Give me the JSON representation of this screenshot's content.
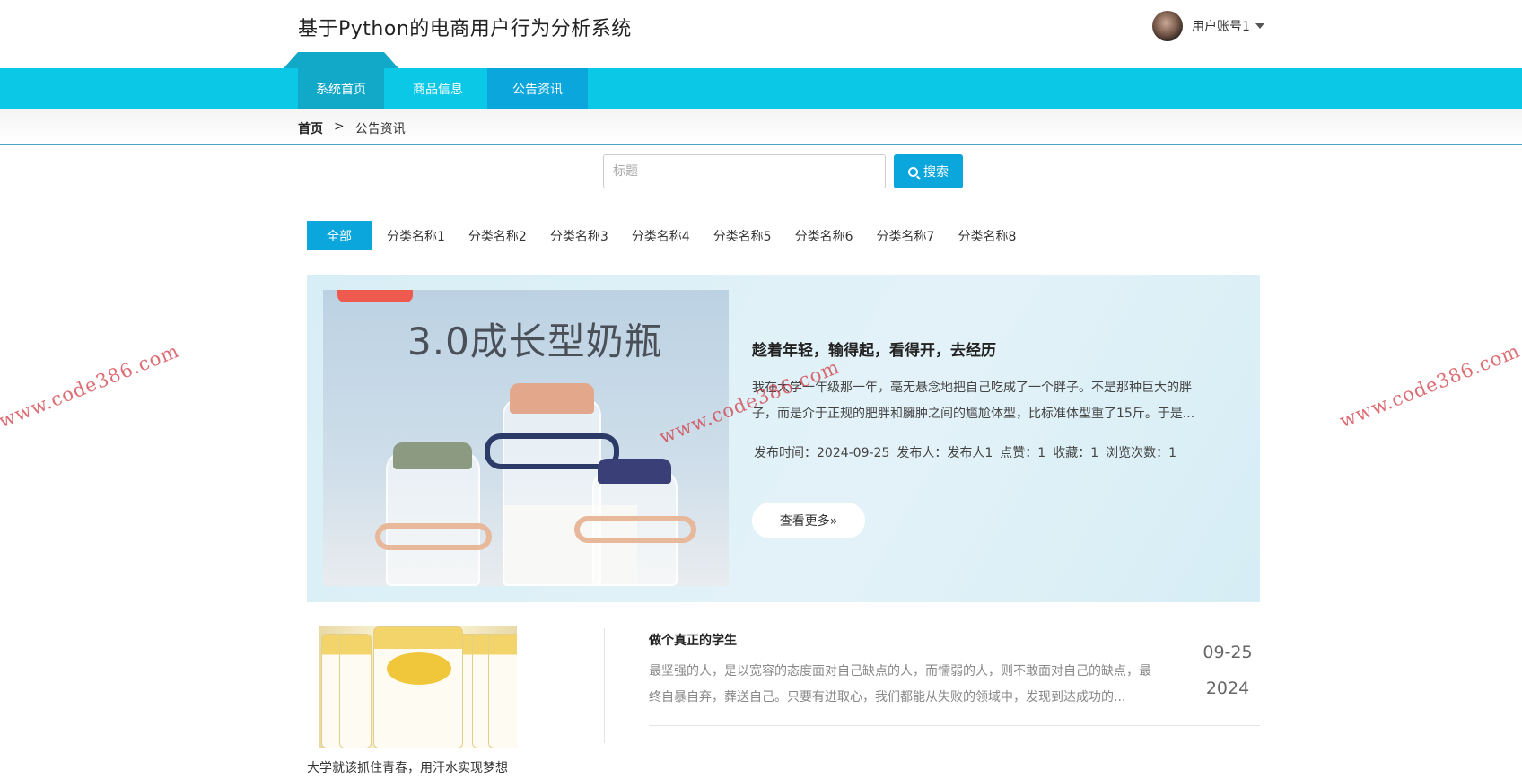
{
  "header": {
    "site_title": "基于Python的电商用户行为分析系统",
    "user_name": "用户账号1"
  },
  "nav": {
    "tabs": [
      {
        "label": "系统首页",
        "active": true
      },
      {
        "label": "商品信息",
        "active": false
      },
      {
        "label": "公告资讯",
        "active": false
      }
    ]
  },
  "breadcrumb": {
    "home": "首页",
    "separator": ">",
    "current": "公告资讯"
  },
  "search": {
    "placeholder": "标题",
    "value": "",
    "button_label": "搜索"
  },
  "categories": [
    "全部",
    "分类名称1",
    "分类名称2",
    "分类名称3",
    "分类名称4",
    "分类名称5",
    "分类名称6",
    "分类名称7",
    "分类名称8"
  ],
  "featured": {
    "image_caption": "3.0成长型奶瓶",
    "title": "趁着年轻，输得起，看得开，去经历",
    "summary": "我在大学一年级那一年，毫无悬念地把自己吃成了一个胖子。不是那种巨大的胖子，而是介于正规的肥胖和臃肿之间的尴尬体型，比标准体型重了15斤。于是...",
    "meta": {
      "publish_time": "发布时间：2024-09-25",
      "publisher": "发布人：发布人1",
      "likes": "点赞：1",
      "favorites": "收藏：1",
      "views": "浏览次数：1"
    },
    "more_label": "查看更多»"
  },
  "list_items": [
    {
      "image_caption": "大学就该抓住青春，用汗水实现梦想",
      "title": "做个真正的学生",
      "summary": "最坚强的人，是以宽容的态度面对自己缺点的人，而懦弱的人，则不敢面对自己的缺点，最终自暴自弃，葬送自己。只要有进取心，我们都能从失败的领域中，发现到达成功的...",
      "date_md": "09-25",
      "date_year": "2024"
    }
  ],
  "watermark": "www.code386.com",
  "colors": {
    "nav_bg": "#0bc8e6",
    "nav_active": "#12a9c9",
    "accent": "#0aa6dc",
    "watermark": "#d23c46"
  }
}
